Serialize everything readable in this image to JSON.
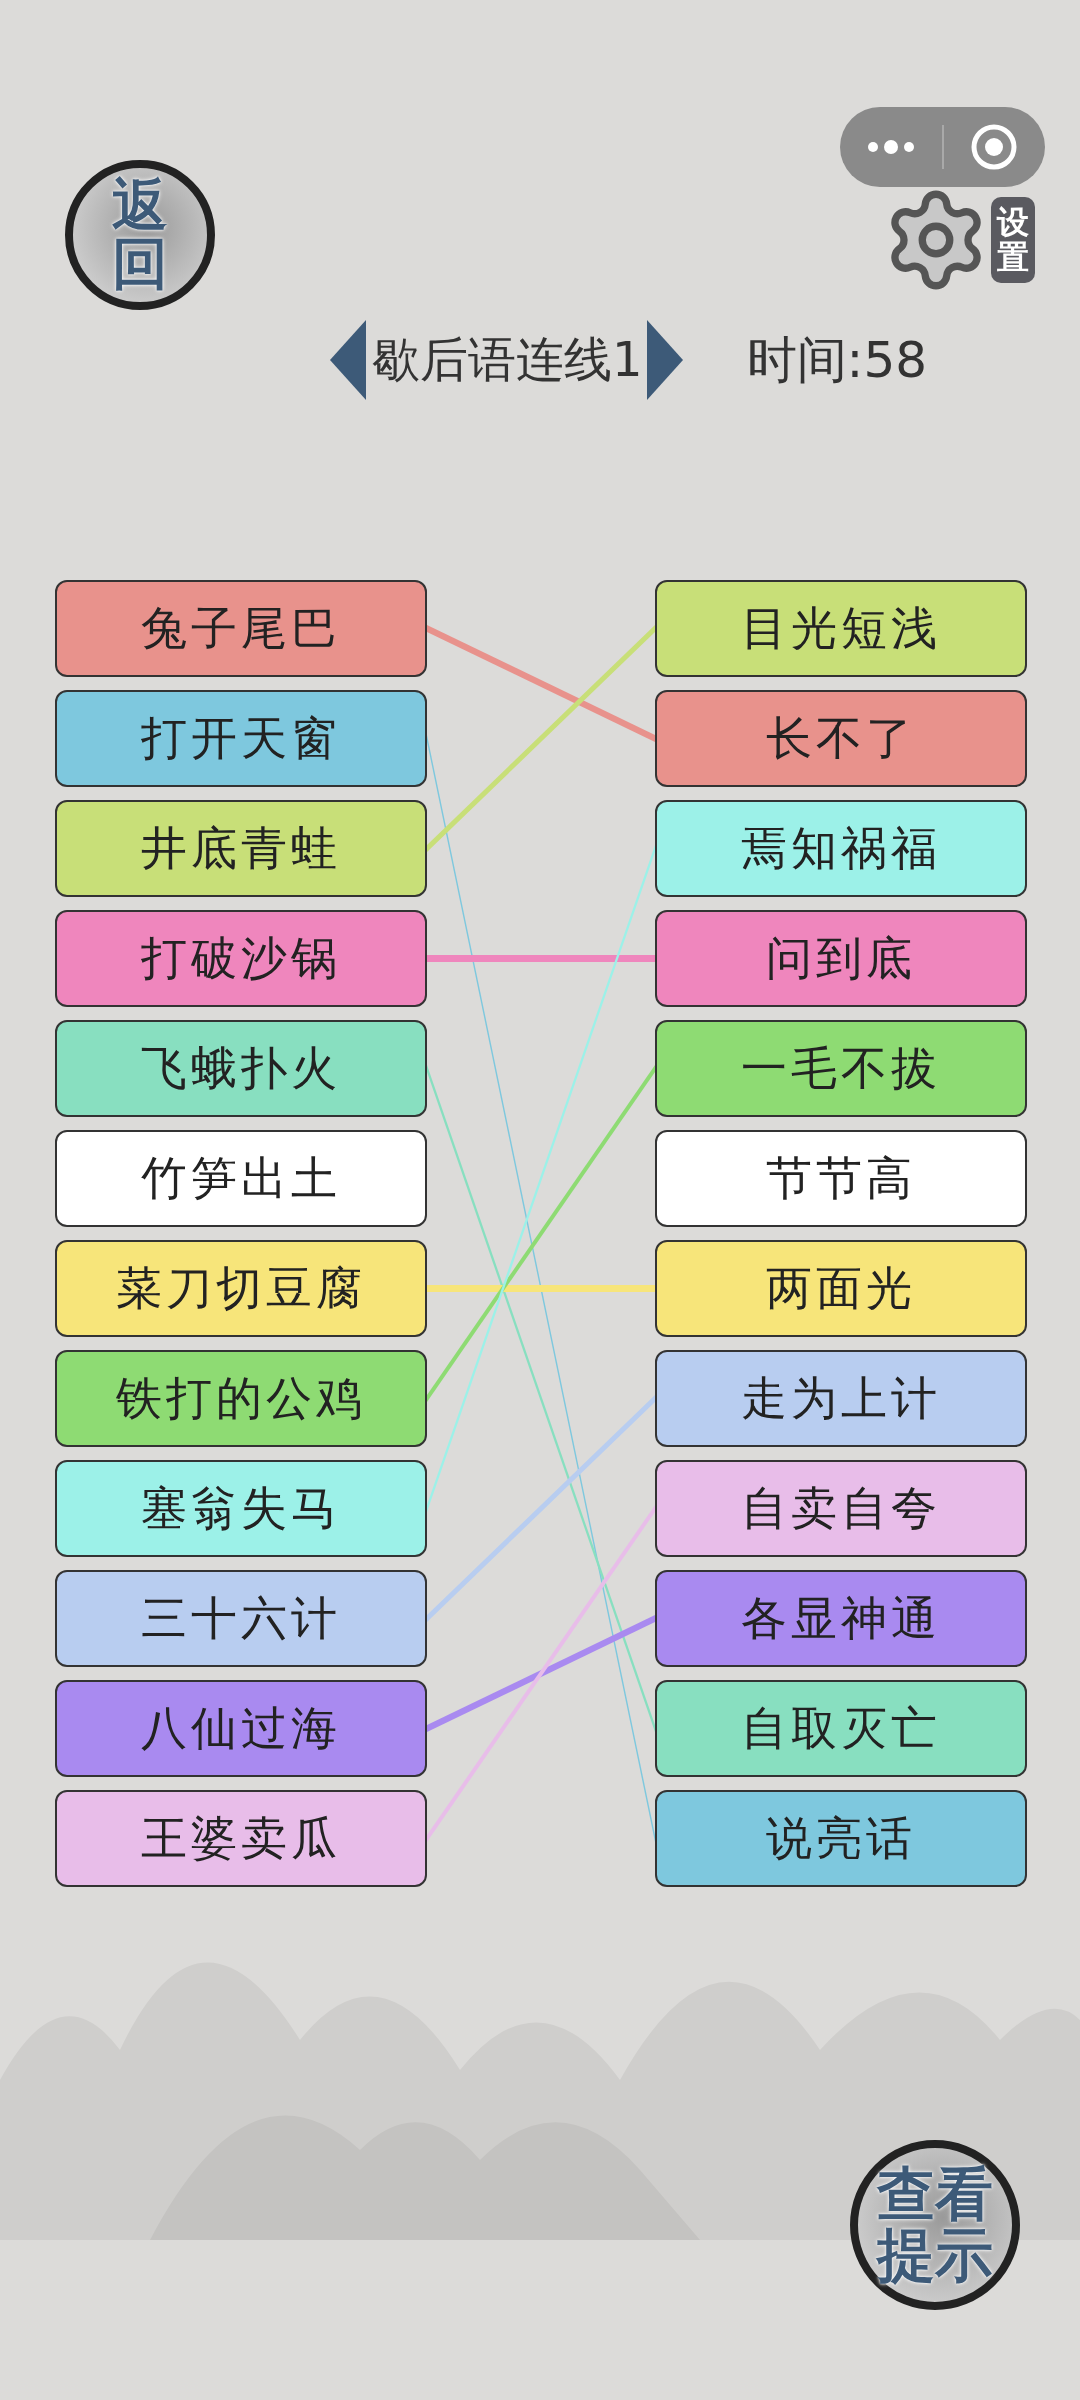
{
  "back_button": {
    "label": "返回"
  },
  "settings_button": {
    "label": "设置"
  },
  "level_title": {
    "label": "歇后语连线1"
  },
  "timer": {
    "label": "时间:58"
  },
  "left_items": [
    {
      "label": "兔子尾巴",
      "color": "#e8928c",
      "connected": true
    },
    {
      "label": "打开天窗",
      "color": "#7ec8de",
      "connected": true
    },
    {
      "label": "井底青蛙",
      "color": "#c8df78",
      "connected": true
    },
    {
      "label": "打破沙锅",
      "color": "#ef86bd",
      "connected": true
    },
    {
      "label": "飞蛾扑火",
      "color": "#88dfc0",
      "connected": true
    },
    {
      "label": "竹笋出土",
      "color": "#ffffff",
      "connected": false
    },
    {
      "label": "菜刀切豆腐",
      "color": "#f7e57a",
      "connected": true
    },
    {
      "label": "铁打的公鸡",
      "color": "#8edb73",
      "connected": true
    },
    {
      "label": "塞翁失马",
      "color": "#9cf1e8",
      "connected": true
    },
    {
      "label": "三十六计",
      "color": "#b8cdf0",
      "connected": true
    },
    {
      "label": "八仙过海",
      "color": "#a98af0",
      "connected": true
    },
    {
      "label": "王婆卖瓜",
      "color": "#e8bde9",
      "connected": true
    }
  ],
  "right_items": [
    {
      "label": "目光短浅",
      "color": "#c8df78"
    },
    {
      "label": "长不了",
      "color": "#e8928c"
    },
    {
      "label": "焉知祸福",
      "color": "#9cf1e8"
    },
    {
      "label": "问到底",
      "color": "#ef86bd"
    },
    {
      "label": "一毛不拔",
      "color": "#8edb73"
    },
    {
      "label": "节节高",
      "color": "#ffffff"
    },
    {
      "label": "两面光",
      "color": "#f7e57a"
    },
    {
      "label": "走为上计",
      "color": "#b8cdf0"
    },
    {
      "label": "自卖自夸",
      "color": "#e8bde9"
    },
    {
      "label": "各显神通",
      "color": "#a98af0"
    },
    {
      "label": "自取灭亡",
      "color": "#88dfc0"
    },
    {
      "label": "说亮话",
      "color": "#7ec8de"
    }
  ],
  "hint_button": {
    "label": "查看提示"
  }
}
